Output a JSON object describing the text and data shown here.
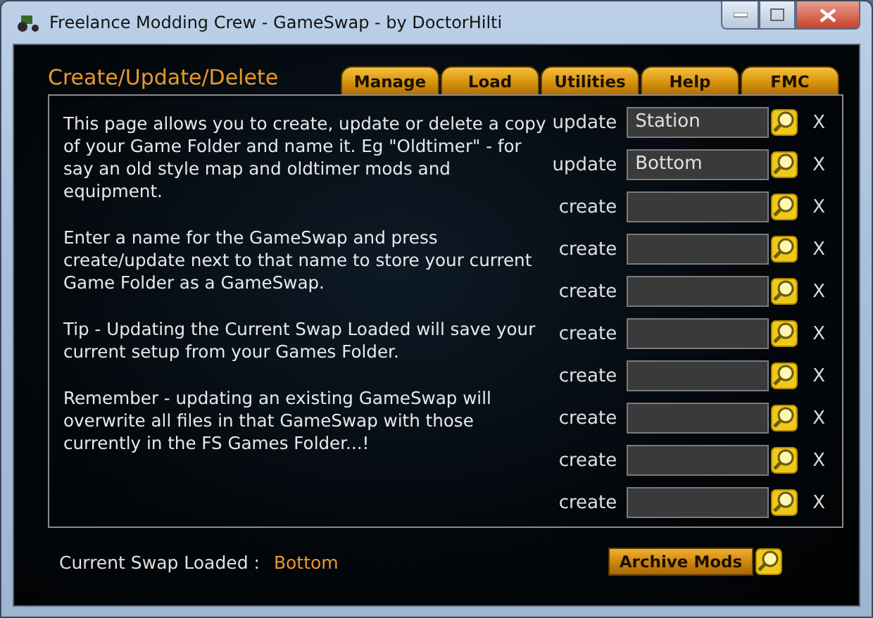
{
  "window": {
    "title": "Freelance Modding Crew - GameSwap - by DoctorHilti"
  },
  "section_title": "Create/Update/Delete",
  "tabs": [
    {
      "label": "Manage"
    },
    {
      "label": "Load"
    },
    {
      "label": "Utilities"
    },
    {
      "label": "Help"
    },
    {
      "label": "FMC"
    }
  ],
  "paragraphs": [
    "This page allows you to create, update or delete a copy of your Game Folder and name it. Eg \"Oldtimer\" - for say an old style map and oldtimer mods and equipment.",
    "Enter a name for the GameSwap and press create/update next to that name to store your current Game Folder as a GameSwap.",
    "Tip - Updating the Current Swap Loaded will save your current setup from your Games Folder.",
    "Remember - updating an existing GameSwap will overwrite all files in that GameSwap with those currently in the FS Games Folder...!"
  ],
  "swaps": [
    {
      "action": "update",
      "value": "Station",
      "delete": "X"
    },
    {
      "action": "update",
      "value": "Bottom",
      "delete": "X"
    },
    {
      "action": "create",
      "delete": "X"
    },
    {
      "action": "create",
      "delete": "X"
    },
    {
      "action": "create",
      "delete": "X"
    },
    {
      "action": "create",
      "delete": "X"
    },
    {
      "action": "create",
      "delete": "X"
    },
    {
      "action": "create",
      "delete": "X"
    },
    {
      "action": "create",
      "delete": "X"
    },
    {
      "action": "create",
      "delete": "X"
    }
  ],
  "status": {
    "label": "Current Swap Loaded :",
    "value": "Bottom"
  },
  "archive_button": "Archive Mods"
}
